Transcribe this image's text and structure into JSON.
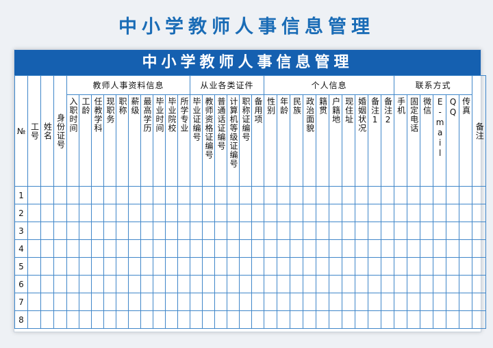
{
  "title": "中小学教师人事信息管理",
  "banner": "中小学教师人事信息管理",
  "groups": {
    "g1": "教师人事资料信息",
    "g2": "从业各类证件",
    "g3": "个人信息",
    "g4": "联系方式"
  },
  "columns": {
    "no": "№",
    "c1": "工号",
    "c2": "姓名",
    "c3": "身份证号",
    "c4": "入职时间",
    "c5": "工龄",
    "c6": "任教学科",
    "c7": "现职务",
    "c8": "职称",
    "c9": "薪级",
    "c10": "最高学历",
    "c11": "毕业时间",
    "c12": "毕业院校",
    "c13": "所学专业",
    "c14": "毕业证编号",
    "c15": "教师资格证编号",
    "c16": "普通话证编号",
    "c17": "计算机等级证编号",
    "c18": "职称证编号",
    "c19": "备用项",
    "c20": "性别",
    "c21": "年龄",
    "c22": "民族",
    "c23": "政治面貌",
    "c24": "籍贯",
    "c25": "户籍地",
    "c26": "现住址",
    "c27": "婚姻状况",
    "c28": "备注1",
    "c29": "备注2",
    "c30": "手机",
    "c31": "固定电话",
    "c32": "微信",
    "c33": "E-mail",
    "c34": "QQ",
    "c35": "传真",
    "c36": "备注"
  },
  "rows": [
    "1",
    "2",
    "3",
    "4",
    "5",
    "6",
    "7",
    "8"
  ]
}
